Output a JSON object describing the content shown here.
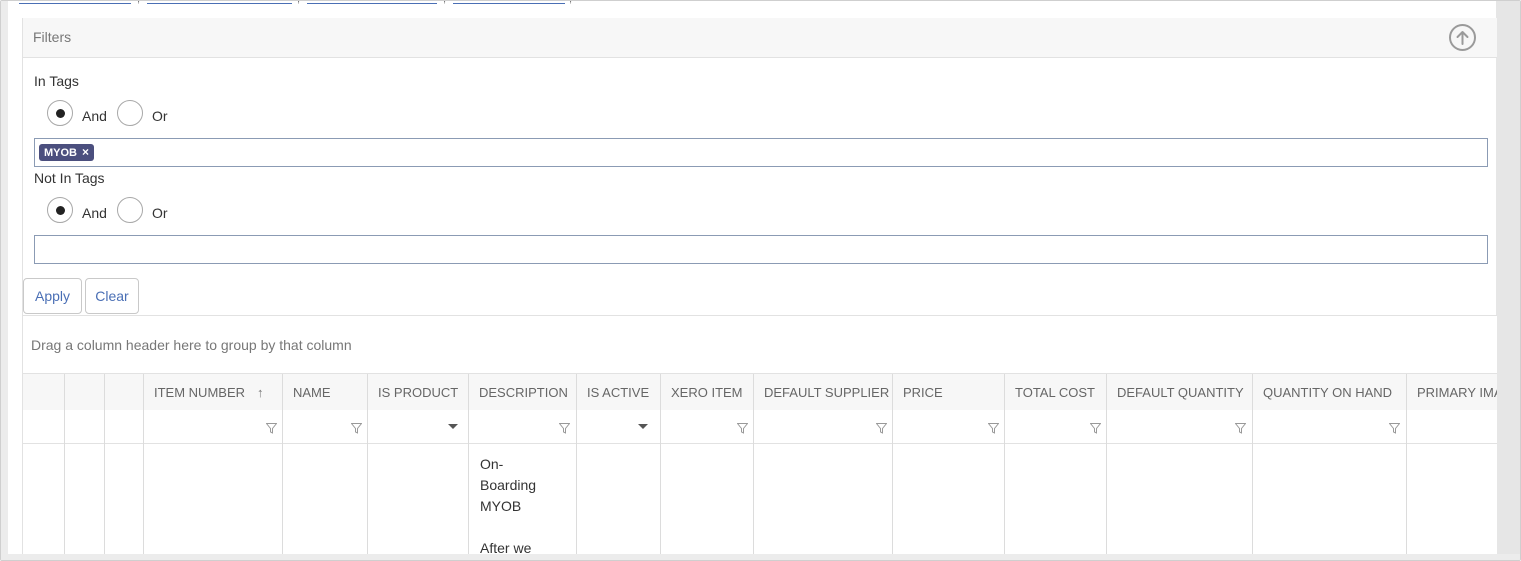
{
  "filters": {
    "title": "Filters",
    "collapse_icon": "arrow-up-circle-icon",
    "in_tags": {
      "label": "In Tags",
      "and_label": "And",
      "or_label": "Or",
      "selected": "And",
      "tags": [
        "MYOB"
      ],
      "remove_glyph": "×"
    },
    "not_in_tags": {
      "label": "Not In Tags",
      "and_label": "And",
      "or_label": "Or",
      "selected": "And",
      "tags": []
    },
    "apply_label": "Apply",
    "clear_label": "Clear"
  },
  "grid": {
    "group_hint": "Drag a column header here to group by that column",
    "sort_glyph": "↑",
    "columns": [
      {
        "label": "",
        "filter": "none"
      },
      {
        "label": "",
        "filter": "none"
      },
      {
        "label": "",
        "filter": "none"
      },
      {
        "label": "ITEM NUMBER",
        "sorted": "ascending",
        "filter": "funnel"
      },
      {
        "label": "NAME",
        "filter": "funnel"
      },
      {
        "label": "IS PRODUCT",
        "filter": "dropdown"
      },
      {
        "label": "DESCRIPTION",
        "filter": "funnel"
      },
      {
        "label": "IS ACTIVE",
        "filter": "dropdown"
      },
      {
        "label": "XERO ITEM",
        "filter": "funnel"
      },
      {
        "label": "DEFAULT SUPPLIER",
        "filter": "funnel"
      },
      {
        "label": "PRICE",
        "filter": "funnel"
      },
      {
        "label": "TOTAL COST",
        "filter": "funnel"
      },
      {
        "label": "DEFAULT QUANTITY",
        "filter": "funnel"
      },
      {
        "label": "QUANTITY ON HAND",
        "filter": "funnel"
      },
      {
        "label": "PRIMARY IMA",
        "filter": "none"
      }
    ],
    "rows": [
      {
        "description_lines": [
          "On-",
          "Boarding",
          "MYOB",
          "",
          "After we"
        ]
      }
    ]
  },
  "colors": {
    "link": "#4a6fb5",
    "tag_chip": "#4b4f7e",
    "header_bg": "#f7f7f7",
    "gutter": "#e6e6e6"
  }
}
